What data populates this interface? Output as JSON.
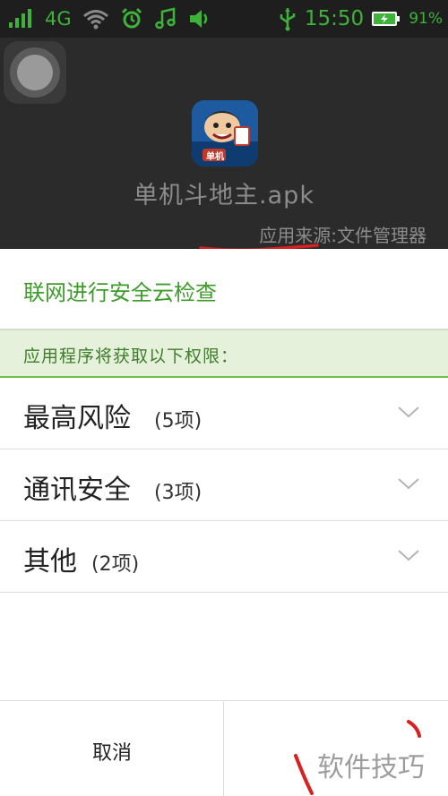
{
  "status_bar": {
    "network": "4G",
    "time": "15:50",
    "battery_percent": "91%",
    "accent_color": "#3fb23a",
    "icons": [
      "signal-icon",
      "wifi-icon",
      "alarm-icon",
      "music-icon",
      "volume-icon",
      "usb-icon",
      "battery-icon"
    ]
  },
  "installer": {
    "app_name": "单机斗地主.apk",
    "app_icon_text": "单机",
    "source": "应用来源:文件管理器"
  },
  "cloud_check": {
    "label": "联网进行安全云检查",
    "color": "#3e9c2a"
  },
  "permissions": {
    "header": "应用程序将获取以下权限：",
    "groups": [
      {
        "title": "最高风险",
        "count": "(5项)"
      },
      {
        "title": "通讯安全",
        "count": "(3项)"
      },
      {
        "title": "其他",
        "count": "(2项)"
      }
    ]
  },
  "footer": {
    "cancel_label": "取消"
  },
  "watermark": "软件技巧"
}
